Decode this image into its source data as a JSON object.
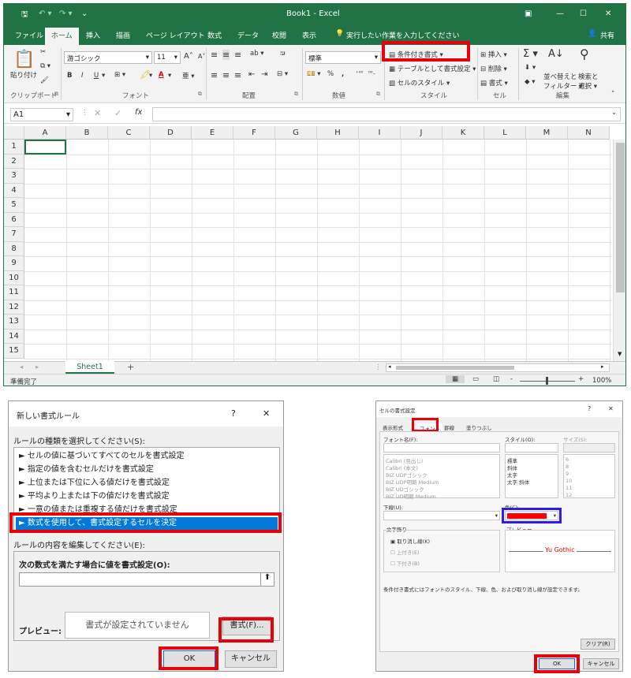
{
  "excel": {
    "title": "Book1 - Excel",
    "quick_access": [
      "save-icon",
      "undo-icon",
      "redo-icon",
      "customize-icon"
    ],
    "window_controls": [
      "ribbon-display-icon",
      "minimize-icon",
      "maximize-icon",
      "close-icon"
    ],
    "tabs": [
      "ファイル",
      "ホーム",
      "挿入",
      "描画",
      "ページ レイアウト",
      "数式",
      "データ",
      "校閲",
      "表示"
    ],
    "active_tab": "ホーム",
    "tell_me": "実行したい作業を入力してください",
    "share": "共有",
    "ribbon": {
      "clipboard": {
        "paste": "貼り付け",
        "group": "クリップボード"
      },
      "font": {
        "name": "游ゴシック",
        "size": "11",
        "group": "フォント",
        "bold": "B",
        "italic": "I",
        "underline": "U",
        "grow": "A",
        "shrink": "A",
        "color_a": "A"
      },
      "alignment": {
        "group": "配置"
      },
      "number": {
        "format": "標準",
        "group": "数値",
        "percent": "%",
        "comma": ","
      },
      "styles": {
        "conditional": "条件付き書式",
        "table": "テーブルとして書式設定",
        "cell_styles": "セルのスタイル",
        "group": "スタイル"
      },
      "cells": {
        "insert": "挿入",
        "delete": "削除",
        "format": "書式",
        "group": "セル"
      },
      "editing": {
        "sort": "並べ替えと",
        "sort2": "フィルター",
        "find": "検索と",
        "find2": "選択",
        "group": "編集"
      }
    },
    "name_box": "A1",
    "fx": "fx",
    "columns": [
      "A",
      "B",
      "C",
      "D",
      "E",
      "F",
      "G",
      "H",
      "I",
      "J",
      "K",
      "L",
      "M",
      "N"
    ],
    "rows": [
      "1",
      "2",
      "3",
      "4",
      "5",
      "6",
      "7",
      "8",
      "9",
      "10",
      "11",
      "12",
      "13",
      "14",
      "15"
    ],
    "sheet_tab": "Sheet1",
    "add_sheet": "+",
    "status": "準備完了",
    "zoom": "100%",
    "zoom_minus": "-",
    "zoom_plus": "+"
  },
  "dialog1": {
    "title": "新しい書式ルール",
    "help": "?",
    "close": "✕",
    "select_label": "ルールの種類を選択してください(S):",
    "rules": [
      "► セルの値に基づいてすべてのセルを書式設定",
      "► 指定の値を含むセルだけを書式設定",
      "► 上位または下位に入る値だけを書式設定",
      "► 平均より上または下の値だけを書式設定",
      "► 一意の値または重複する値だけを書式設定",
      "► 数式を使用して、書式設定するセルを決定"
    ],
    "edit_label": "ルールの内容を編集してください(E):",
    "formula_label": "次の数式を満たす場合に値を書式設定(O):",
    "formula_value": "",
    "preview_label": "プレビュー:",
    "preview_text": "書式が設定されていません",
    "format_button": "書式(F)...",
    "ok": "OK",
    "cancel": "キャンセル"
  },
  "dialog2": {
    "title": "セルの書式設定",
    "help": "?",
    "close": "✕",
    "tabs": [
      "表示形式",
      "フォント",
      "罫線",
      "塗りつぶし"
    ],
    "font_name_label": "フォント名(F):",
    "style_label": "スタイル(O):",
    "size_label": "サイズ(S):",
    "fonts": [
      "Calibri (見出し)",
      "Calibri (本文)",
      "BIZ UDPゴシック",
      "BIZ UDP明朝 Medium",
      "BIZ UDゴシック",
      "BIZ UD明朝 Medium"
    ],
    "styles": [
      "標準",
      "斜体",
      "太字",
      "太字 斜体"
    ],
    "sizes": [
      "6",
      "8",
      "9",
      "10",
      "11",
      "12"
    ],
    "underline_label": "下線(U):",
    "color_label": "色(C):",
    "color_value": "#ff0000",
    "effects_label": "文字飾り",
    "strike": "取り消し線(K)",
    "superscript": "上付き(E)",
    "subscript": "下付き(B)",
    "preview_label": "プレビュー",
    "preview_text": "Yu Gothic",
    "note": "条件付き書式にはフォントのスタイル、下線、色、および取り消し線が設定できます。",
    "clear": "クリア(R)",
    "ok": "OK",
    "cancel": "キャンセル"
  },
  "colors": {
    "excel_green": "#217346",
    "highlight_red": "#e8000a",
    "highlight_blue": "#2f1af0",
    "selected_blue": "#0078d7"
  }
}
